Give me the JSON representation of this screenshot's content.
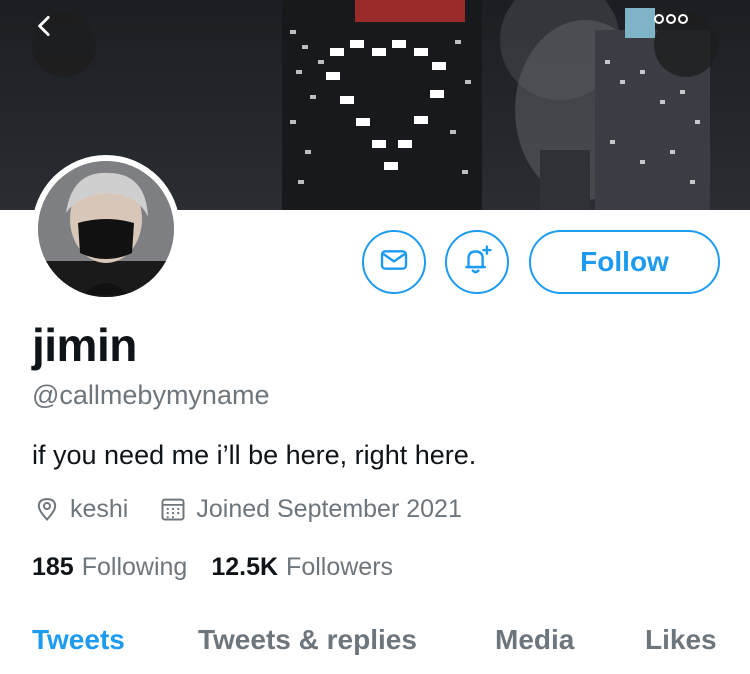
{
  "header": {
    "back_icon": "chevron-left-icon",
    "more_icon": "more-horizontal-icon"
  },
  "profile": {
    "display_name": "jimin",
    "handle": "@callmebymyname",
    "bio": "if you need me i’ll be here, right here.",
    "location": "keshi",
    "joined": "Joined September 2021",
    "following_count": "185",
    "following_label": "Following",
    "followers_count": "12.5K",
    "followers_label": "Followers"
  },
  "actions": {
    "message_icon": "envelope-icon",
    "notify_icon": "bell-plus-icon",
    "follow_label": "Follow"
  },
  "tabs": [
    {
      "label": "Tweets",
      "active": true
    },
    {
      "label": "Tweets & replies",
      "active": false
    },
    {
      "label": "Media",
      "active": false
    },
    {
      "label": "Likes",
      "active": false
    }
  ],
  "colors": {
    "accent": "#1d9bf0",
    "text_primary": "#0f1419",
    "text_secondary": "#6e767d"
  }
}
